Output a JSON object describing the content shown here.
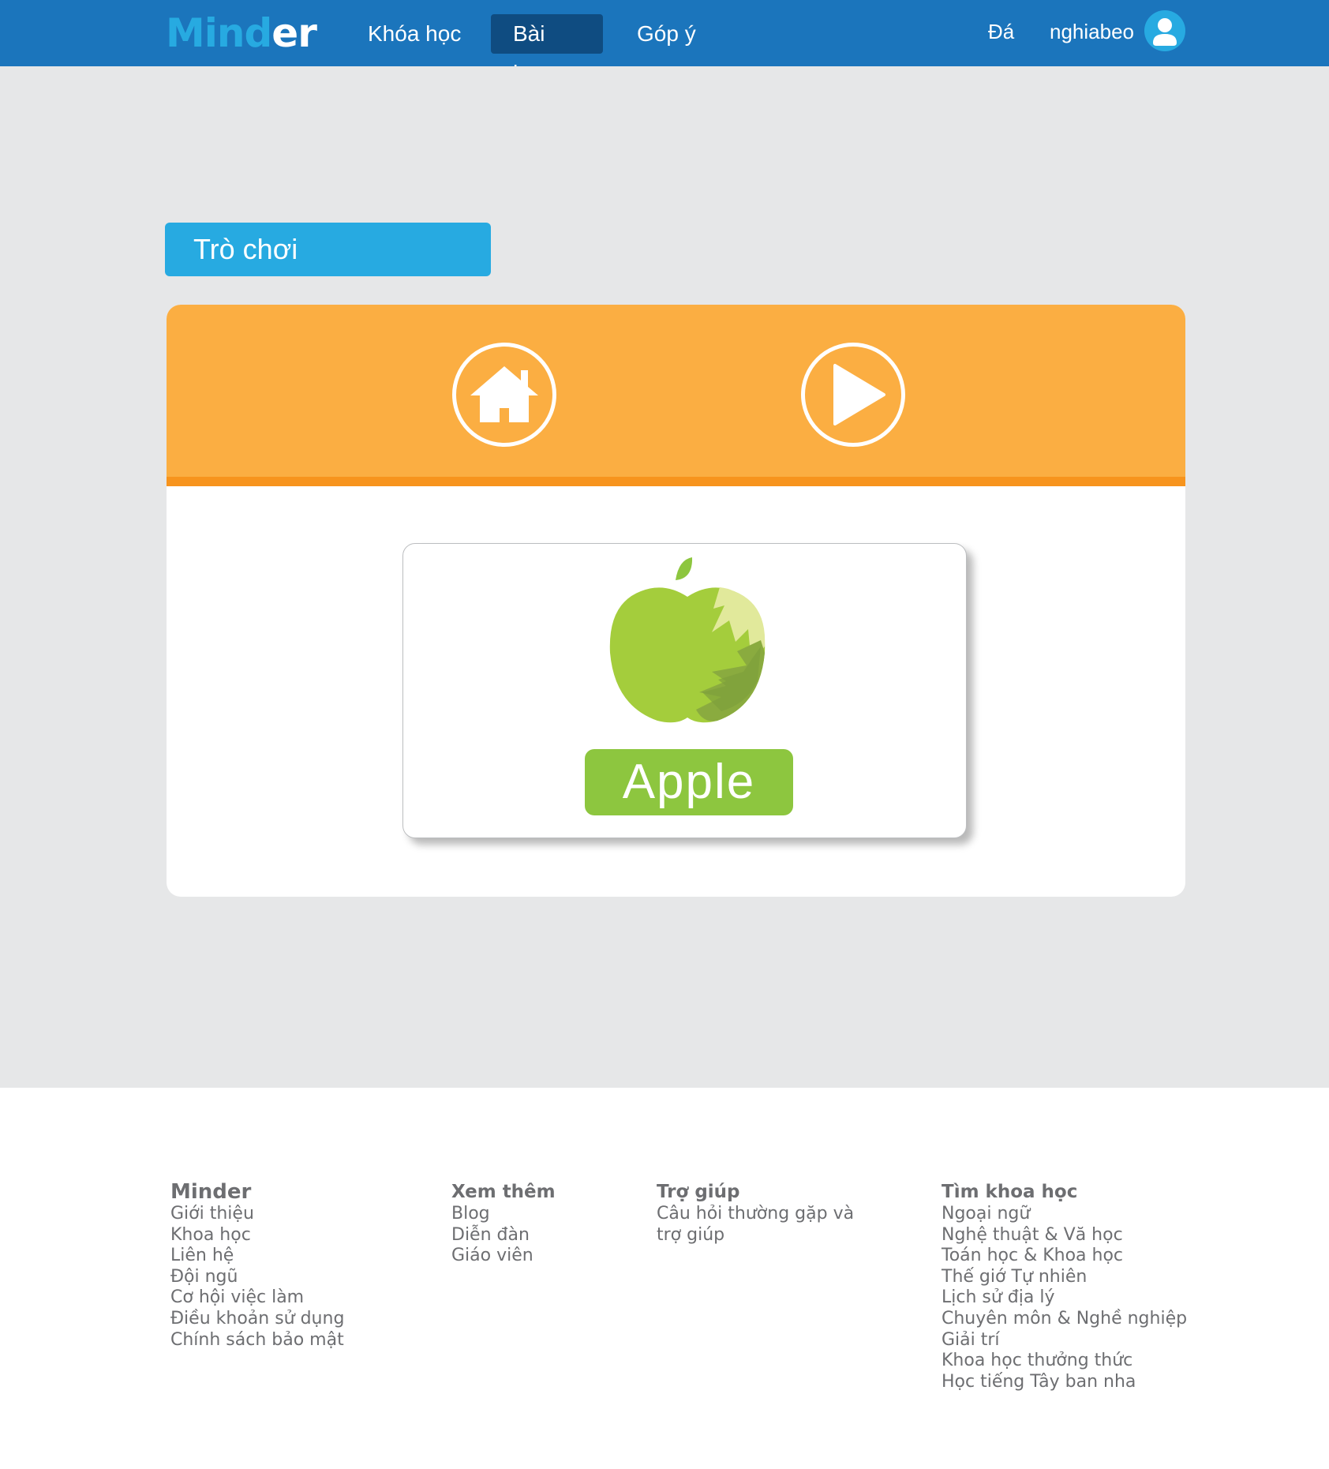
{
  "header": {
    "logo": {
      "part1": "Mind",
      "part2": "er"
    },
    "nav": [
      {
        "label": "Khóa học"
      },
      {
        "label": "Bài học",
        "active": true
      },
      {
        "label": "Góp ý"
      }
    ],
    "right_link": "Đá",
    "username": "nghiabeo",
    "avatar_icon": "user-icon"
  },
  "main": {
    "section_title": "Trò chơi",
    "toolbar": {
      "home_icon": "home-icon",
      "play_icon": "play-icon"
    },
    "card": {
      "image_icon": "apple-icon",
      "word": "Apple"
    }
  },
  "footer": {
    "columns": [
      {
        "title": "Minder",
        "links": [
          "Giới thiệu",
          "Khoa học",
          "Liên hệ",
          "Đội ngũ",
          "Cơ hội việc làm",
          "Điều khoản sử dụng",
          "Chính sách bảo mật"
        ]
      },
      {
        "title": "Xem thêm",
        "links": [
          "Blog",
          "Diễn đàn",
          "Giáo viên"
        ]
      },
      {
        "title": "Trợ giúp",
        "links": [
          "Câu hỏi thường gặp và",
          "trợ giúp"
        ]
      },
      {
        "title": "Tìm khoa học",
        "links": [
          "Ngoại ngữ",
          "Nghệ thuật & Vă học",
          "Toán học & Khoa học",
          "Thế giớ Tự nhiên",
          "Lịch sử địa lý",
          "Chuyên môn & Nghề nghiệp",
          "Giải trí",
          "Khoa học thưởng thức",
          "Học tiếng Tây ban nha"
        ]
      }
    ]
  },
  "colors": {
    "header_bg": "#1b75bc",
    "nav_active_bg": "#0f4c81",
    "accent_blue": "#27aae1",
    "toolbar_orange": "#fbae42",
    "toolbar_line": "#f7941d",
    "card_label_green": "#8dc63f",
    "page_bg": "#e6e7e8",
    "footer_text": "#6d6e71"
  }
}
